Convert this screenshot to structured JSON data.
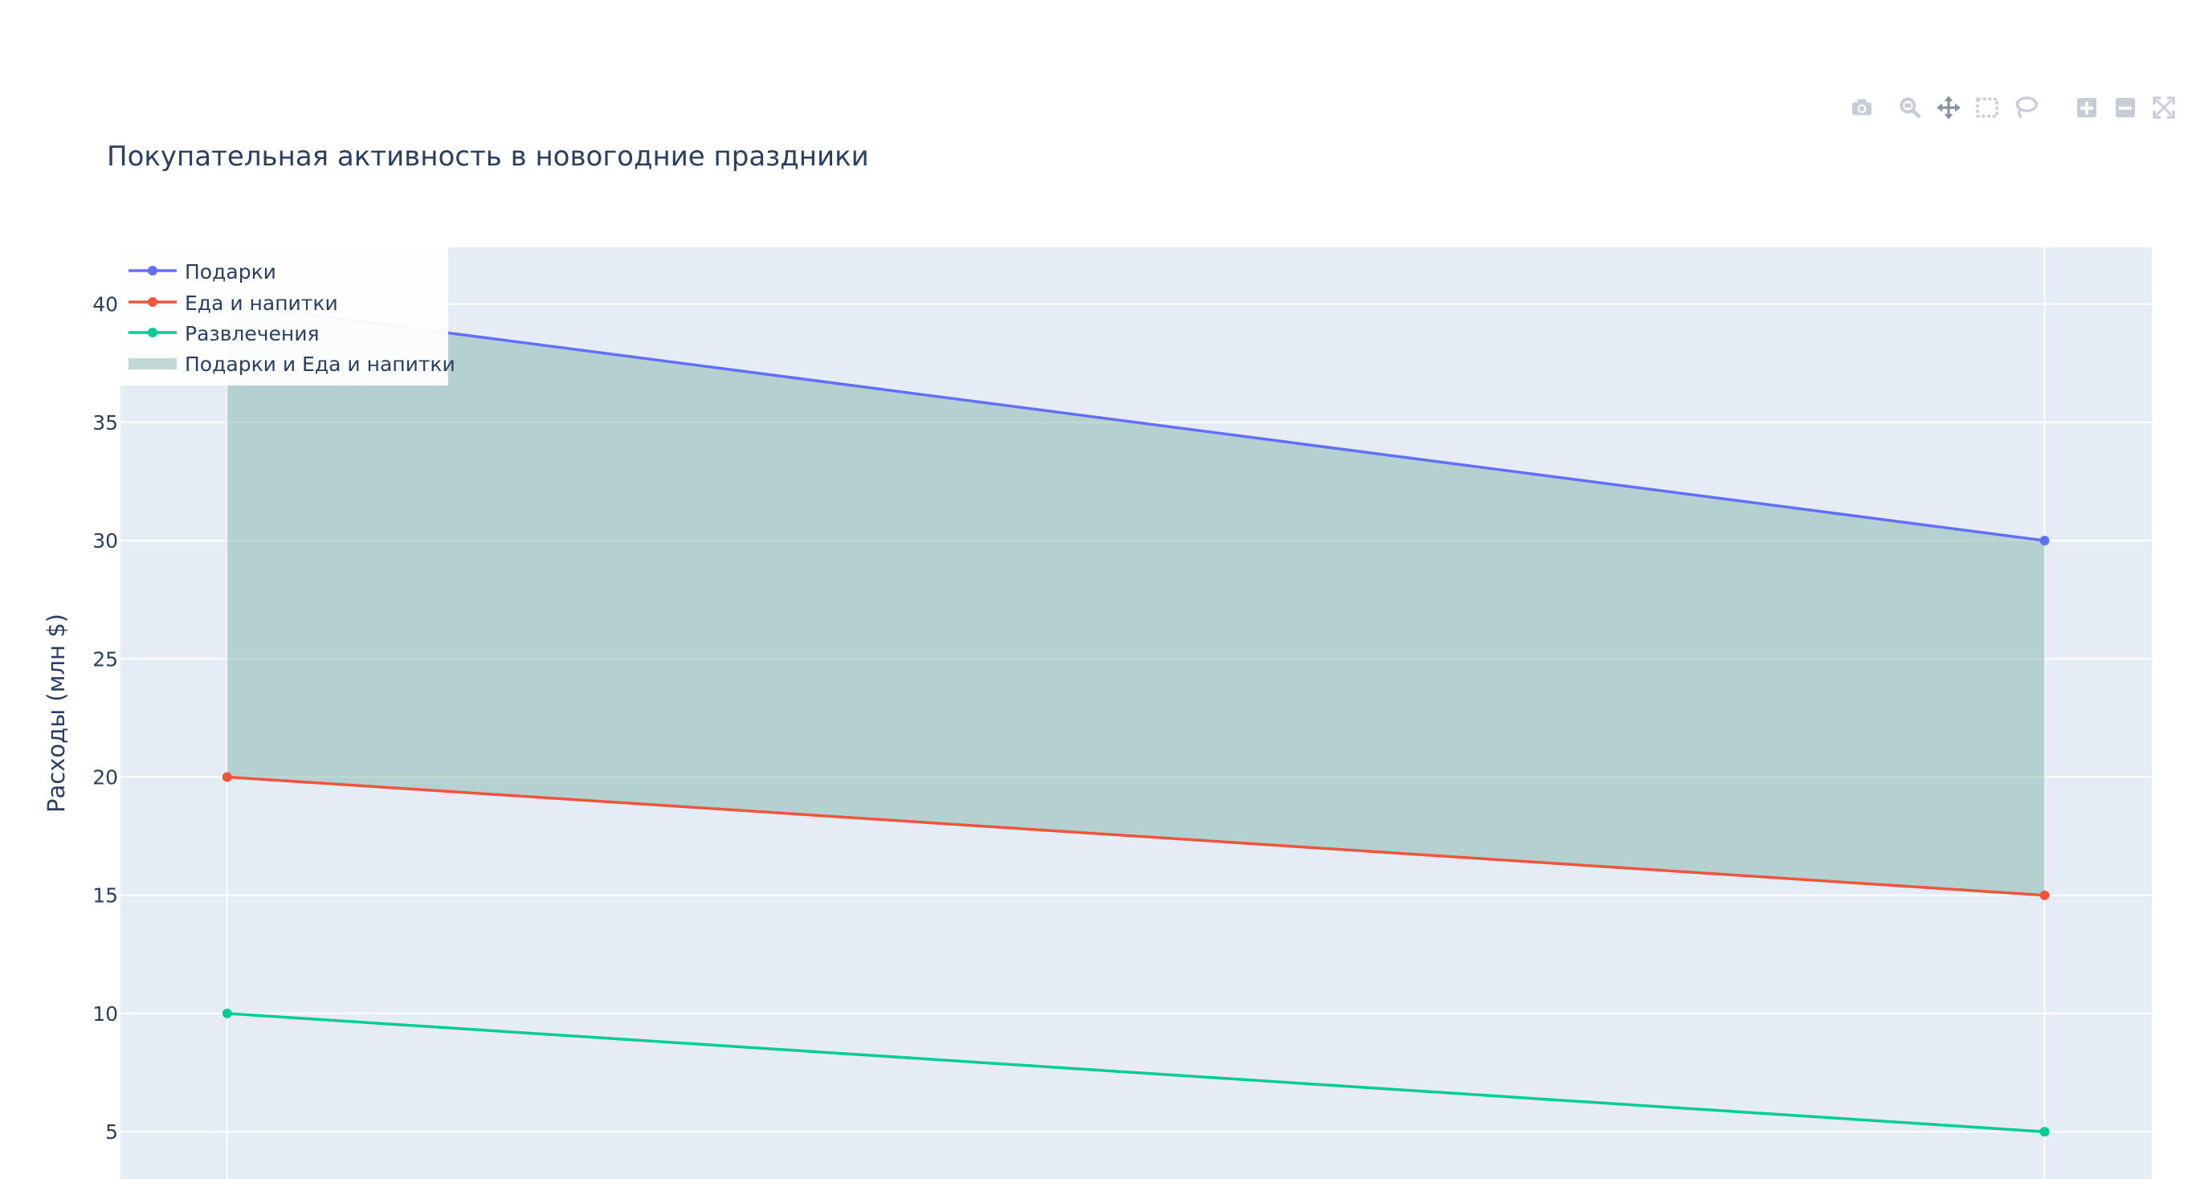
{
  "modebar": {
    "icons": [
      "camera-icon",
      "zoom-icon",
      "pan-icon",
      "box-select-icon",
      "lasso-select-icon",
      "zoom-in-icon",
      "zoom-out-icon",
      "autoscale-icon"
    ]
  },
  "chart_data": {
    "type": "line",
    "title": "Покупательная активность в новогодние праздники",
    "xlabel": "",
    "ylabel": "Расходы (млн $)",
    "x": [
      0,
      1
    ],
    "xlim": [
      -0.0587,
      1.059
    ],
    "ylim": [
      3.0,
      42.4
    ],
    "yticks": [
      5,
      10,
      15,
      20,
      25,
      30,
      35,
      40
    ],
    "grid": true,
    "plot_bgcolor": "#E5ECF6",
    "series": [
      {
        "name": "Подарки",
        "values": [
          40,
          30
        ],
        "color": "#636EFA",
        "mode": "lines+markers"
      },
      {
        "name": "Еда и напитки",
        "values": [
          20,
          15
        ],
        "color": "#EF553B",
        "mode": "lines+markers"
      },
      {
        "name": "Развлечения",
        "values": [
          10,
          5
        ],
        "color": "#00CC96",
        "mode": "lines+markers"
      }
    ],
    "fill": {
      "name": "Подарки и Еда и напитки",
      "upper": "Подарки",
      "lower": "Еда и напитки",
      "color": "rgba(132,179,169,0.5)"
    },
    "legend": {
      "placement": "top-left"
    }
  }
}
